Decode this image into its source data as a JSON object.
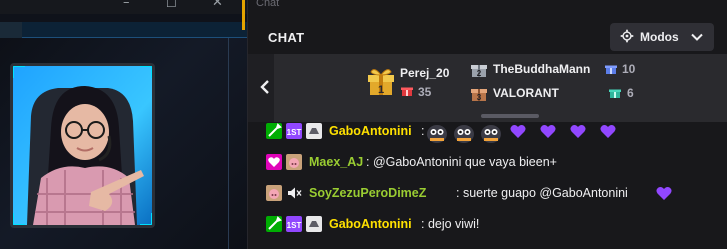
{
  "window": {
    "caption": "Chat"
  },
  "chat": {
    "title": "CHAT",
    "modes_label": "Modos"
  },
  "leaderboard": {
    "entries": [
      {
        "rank": "1",
        "name": "Perej_20",
        "gifts": "35"
      },
      {
        "rank": "2",
        "name": "TheBuddhaMann",
        "gifts": "10"
      },
      {
        "rank": "3",
        "name": "VALORANT",
        "gifts": "6"
      }
    ]
  },
  "messages": [
    {
      "user": "GaboAntonini",
      "text": ":",
      "user_color": "#ffe100"
    },
    {
      "user": "Maex_AJ",
      "text": ": @GaboAntonini que vaya bieen+",
      "user_color": "#9acd32"
    },
    {
      "user": "SoyZezuPeroDimeZ",
      "text": ": suerte guapo @GaboAntonini",
      "user_color": "#9acd32"
    },
    {
      "user": "GaboAntonini",
      "text": ": dejo viwi!",
      "user_color": "#ffe100"
    }
  ],
  "colors": {
    "background": "#18181b",
    "leaderboard": "#2a2a2e",
    "accent_purple": "#9147ff",
    "gold": "#e5a400"
  },
  "icons": [
    "minimize-icon",
    "maximize-icon",
    "close-icon",
    "gear-icon",
    "chevron-down-icon",
    "chevron-left-icon",
    "gift-icon",
    "heart-emote",
    "mute-icon",
    "moderator-badge",
    "subscriber-badge",
    "prime-badge"
  ]
}
